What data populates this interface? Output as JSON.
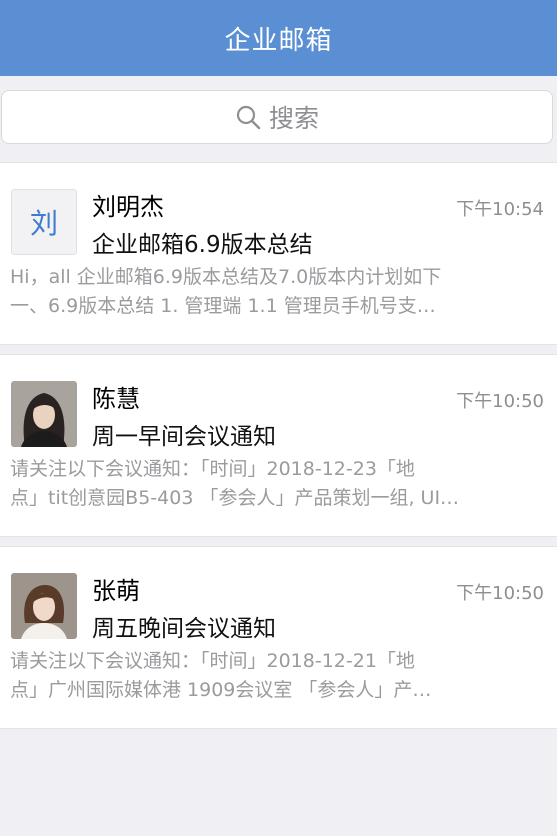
{
  "header": {
    "title": "企业邮箱"
  },
  "search": {
    "placeholder": "搜索"
  },
  "mails": [
    {
      "avatar_text": "刘",
      "sender": "刘明杰",
      "time": "下午10:54",
      "subject": "企业邮箱6.9版本总结",
      "preview_line1": "Hi，all 企业邮箱6.9版本总结及7.0版本内计划如下",
      "preview_line2": "一、6.9版本总结 1. 管理端 1.1 管理员手机号支…"
    },
    {
      "sender": "陈慧",
      "time": "下午10:50",
      "subject": "周一早间会议通知",
      "preview_line1": "请关注以下会议通知：「时间」2018-12-23「地",
      "preview_line2": "点」tit创意园B5-403 「参会人」产品策划一组, UI…"
    },
    {
      "sender": "张萌",
      "time": "下午10:50",
      "subject": "周五晚间会议通知",
      "preview_line1": "请关注以下会议通知：「时间」2018-12-21「地",
      "preview_line2": "点」广州国际媒体港 1909会议室 「参会人」产…"
    }
  ],
  "colors": {
    "header_bg": "#5b8fd4",
    "page_bg": "#efeff4",
    "avatar_text": "#3f7ccf",
    "muted_text": "#8e8e93"
  },
  "icons": {
    "search": "search-icon"
  }
}
